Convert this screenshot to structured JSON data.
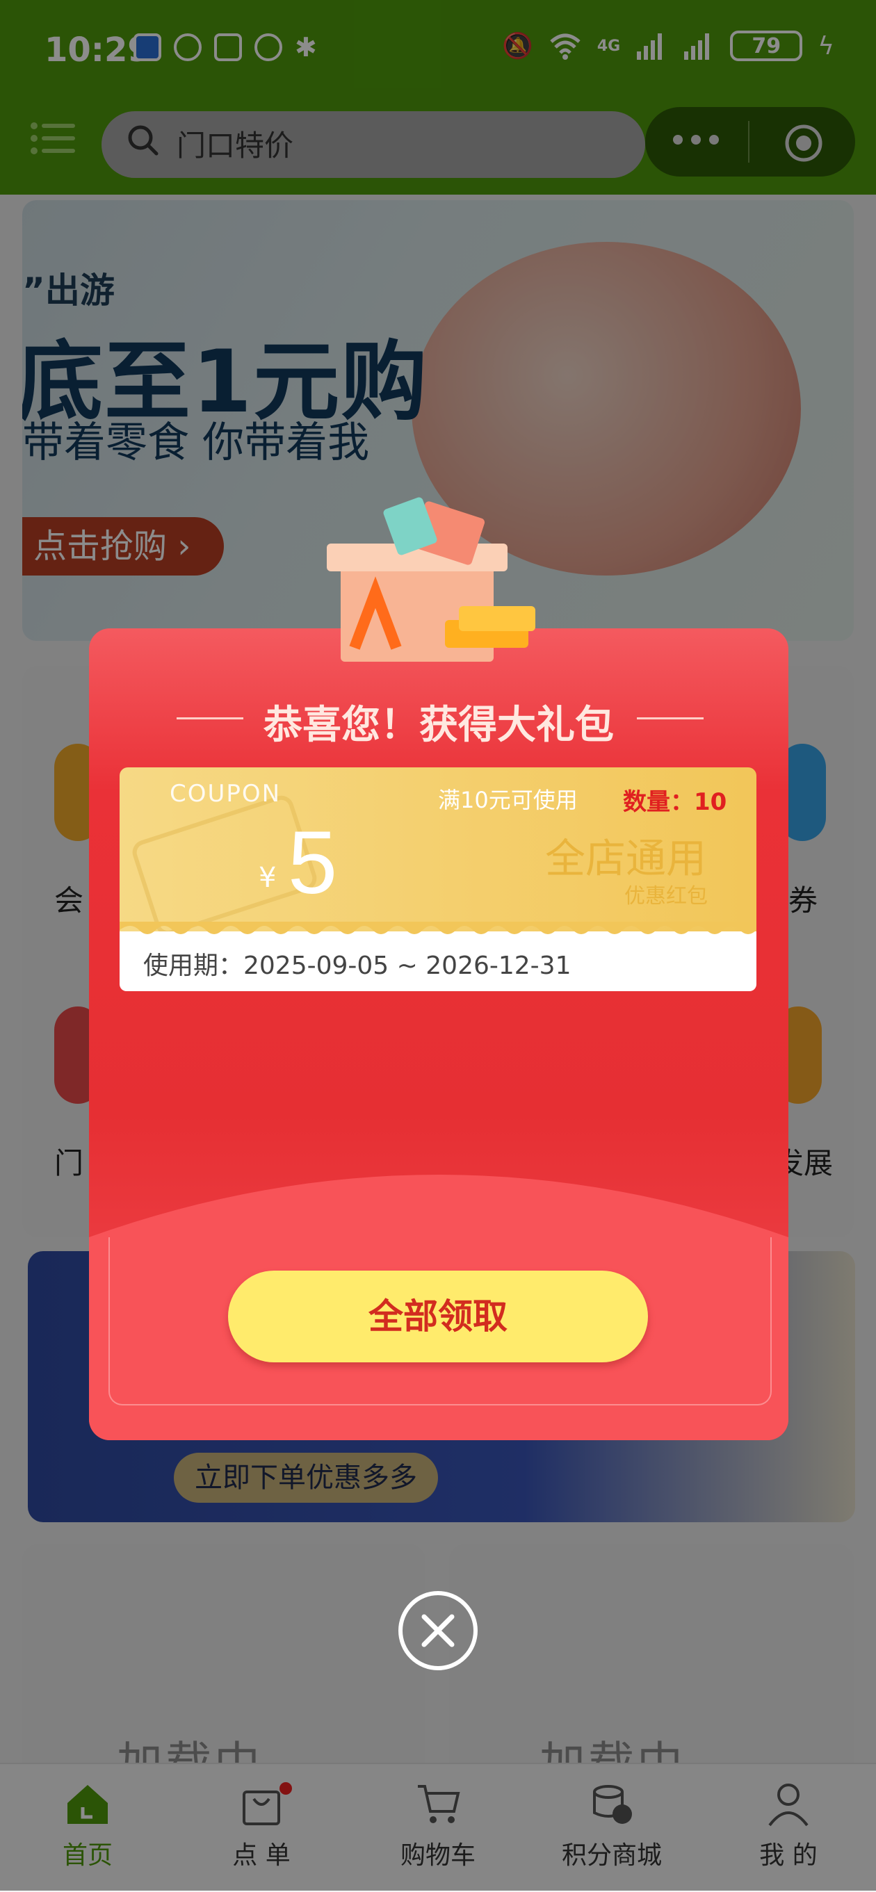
{
  "status_bar": {
    "time": "10:29",
    "battery": "79",
    "network": "4G"
  },
  "header": {
    "search_placeholder": "门口特价"
  },
  "banner": {
    "line1": "”出游",
    "line2": "底至1元购",
    "line3": "带着零食 你带着我",
    "button": "点击抢购"
  },
  "grid_labels": {
    "r1_left": "会",
    "r1_right": "券",
    "r2_left": "门",
    "r2_right": "发展"
  },
  "promo": {
    "pill": "立即下单优惠多多"
  },
  "loading": {
    "left": "加载中",
    "right": "加载中"
  },
  "tabs": [
    {
      "label": "首页",
      "icon": "home-icon",
      "active": true
    },
    {
      "label": "点 单",
      "icon": "bag-icon",
      "active": false
    },
    {
      "label": "购物车",
      "icon": "cart-icon",
      "active": false
    },
    {
      "label": "积分商城",
      "icon": "coins-icon",
      "active": false
    },
    {
      "label": "我 的",
      "icon": "user-icon",
      "active": false
    }
  ],
  "modal": {
    "title": "恭喜您！获得大礼包",
    "coupon": {
      "word": "COUPON",
      "currency": "¥",
      "amount": "5",
      "condition": "满10元可使用",
      "quantity": "数量：10",
      "scope": "全店通用",
      "type": "优惠红包",
      "validity": "使用期：2025-09-05 ~ 2026-12-31"
    },
    "claim_button": "全部领取"
  },
  "colors": {
    "brand_green": "#4f9a0b",
    "modal_red": "#ea3137",
    "button_yellow": "#ffeb6c"
  }
}
